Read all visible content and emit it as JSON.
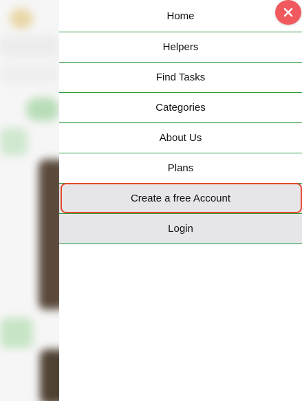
{
  "menu": {
    "items": [
      {
        "label": "Home"
      },
      {
        "label": "Helpers"
      },
      {
        "label": "Find Tasks"
      },
      {
        "label": "Categories"
      },
      {
        "label": "About Us"
      },
      {
        "label": "Plans"
      },
      {
        "label": "Create a free Account"
      },
      {
        "label": "Login"
      }
    ],
    "highlighted_item": "Create a free Account"
  },
  "close_button": {
    "icon": "close-icon"
  },
  "colors": {
    "divider": "#2e9b3e",
    "highlight_border": "#e8482e",
    "close_button_bg": "#f05a5f",
    "shaded_item_bg": "#e6e6e9"
  }
}
